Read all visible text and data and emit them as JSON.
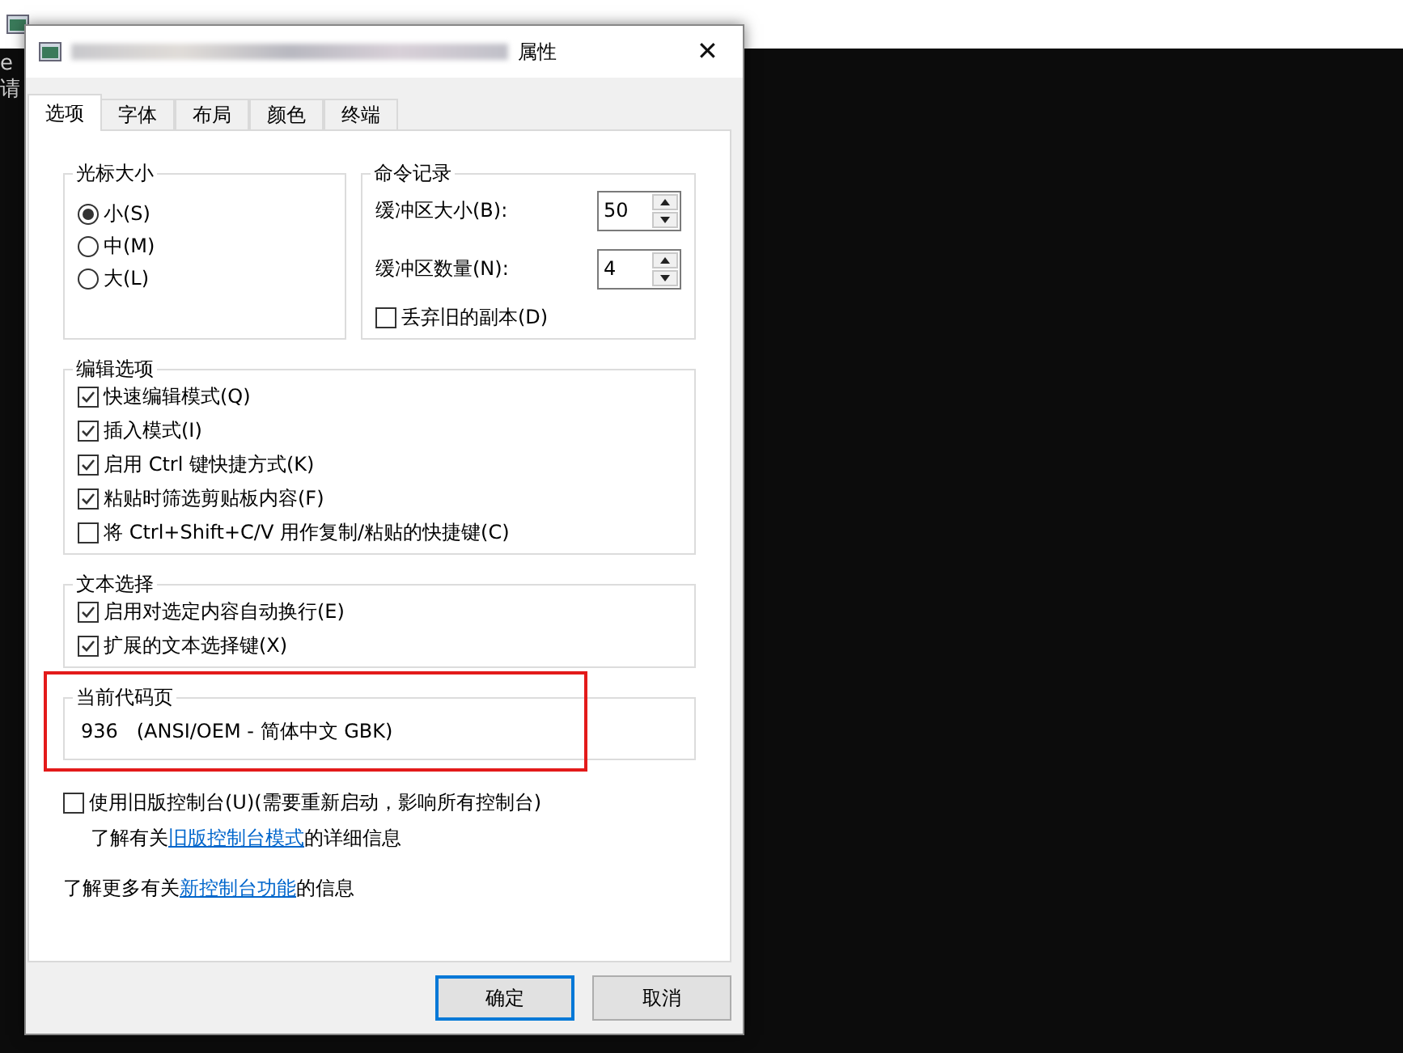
{
  "background_window": {
    "console_lines": [
      "e",
      "请"
    ]
  },
  "dialog": {
    "title": "属性",
    "close": "✕"
  },
  "tabs": [
    {
      "label": "选项",
      "selected": true
    },
    {
      "label": "字体",
      "selected": false
    },
    {
      "label": "布局",
      "selected": false
    },
    {
      "label": "颜色",
      "selected": false
    },
    {
      "label": "终端",
      "selected": false
    }
  ],
  "cursor_size": {
    "title": "光标大小",
    "options": [
      {
        "label": "小(S)",
        "selected": true
      },
      {
        "label": "中(M)",
        "selected": false
      },
      {
        "label": "大(L)",
        "selected": false
      }
    ]
  },
  "command_history": {
    "title": "命令记录",
    "spinners": [
      {
        "label": "缓冲区大小(B):",
        "value": "50"
      },
      {
        "label": "缓冲区数量(N):",
        "value": "4"
      }
    ],
    "discard": {
      "label": "丢弃旧的副本(D)",
      "checked": false
    }
  },
  "edit_options": {
    "title": "编辑选项",
    "items": [
      {
        "label": "快速编辑模式(Q)",
        "checked": true
      },
      {
        "label": "插入模式(I)",
        "checked": true
      },
      {
        "label": "启用 Ctrl 键快捷方式(K)",
        "checked": true
      },
      {
        "label": "粘贴时筛选剪贴板内容(F)",
        "checked": true
      },
      {
        "label": "将 Ctrl+Shift+C/V 用作复制/粘贴的快捷键(C)",
        "checked": false
      }
    ]
  },
  "text_selection": {
    "title": "文本选择",
    "items": [
      {
        "label": "启用对选定内容自动换行(E)",
        "checked": true
      },
      {
        "label": "扩展的文本选择键(X)",
        "checked": true
      }
    ]
  },
  "code_page": {
    "title": "当前代码页",
    "value": "936   (ANSI/OEM - 简体中文 GBK)",
    "highlighted": true
  },
  "legacy": {
    "label": "使用旧版控制台(U)(需要重新启动，影响所有控制台)",
    "checked": false
  },
  "legacy_info": {
    "before": "了解有关",
    "link": "旧版控制台模式",
    "after": "的详细信息"
  },
  "new_features": {
    "before": "了解更多有关",
    "link": "新控制台功能",
    "after": "的信息"
  },
  "buttons": [
    {
      "label": "确定",
      "default": true
    },
    {
      "label": "取消",
      "default": false
    }
  ]
}
